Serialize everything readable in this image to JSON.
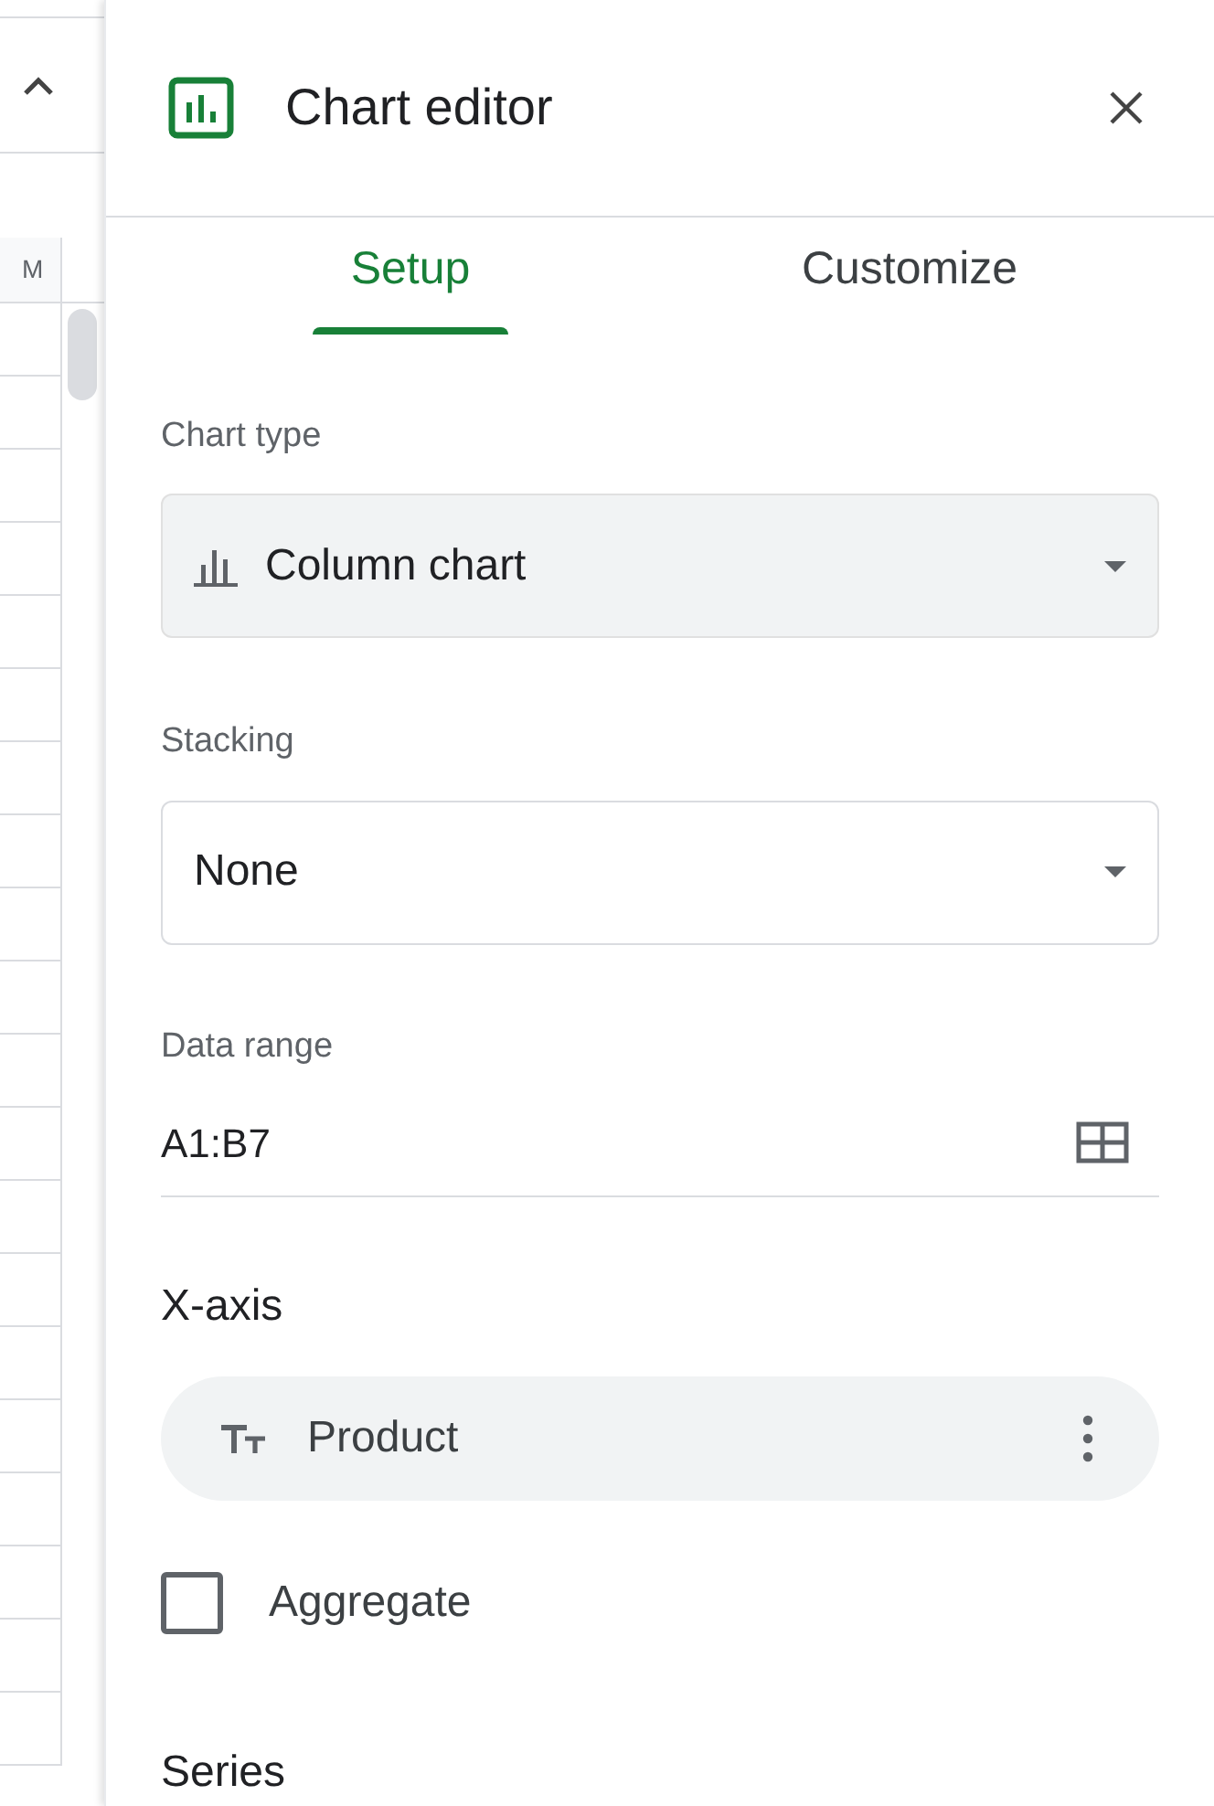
{
  "sheet": {
    "column_header": "M"
  },
  "panel": {
    "title": "Chart editor"
  },
  "tabs": [
    {
      "label": "Setup",
      "selected": true
    },
    {
      "label": "Customize",
      "selected": false
    }
  ],
  "chart_type": {
    "label": "Chart type",
    "value": "Column chart"
  },
  "stacking": {
    "label": "Stacking",
    "value": "None"
  },
  "data_range": {
    "label": "Data range",
    "value": "A1:B7"
  },
  "x_axis": {
    "heading": "X-axis",
    "field": "Product"
  },
  "aggregate": {
    "label": "Aggregate",
    "checked": false
  },
  "series": {
    "heading": "Series"
  }
}
